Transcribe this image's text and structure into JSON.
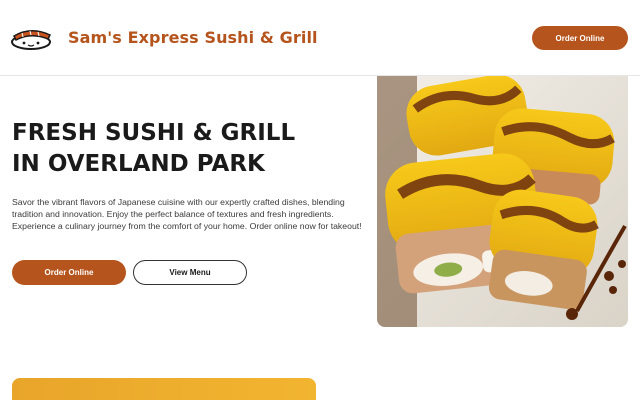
{
  "header": {
    "brand": "Sam's Express Sushi & Grill",
    "order_label": "Order Online",
    "logo_icon": "sushi-logo-icon"
  },
  "hero": {
    "title_line1": "FRESH SUSHI & GRILL",
    "title_line2": "IN OVERLAND PARK",
    "description": "Savor the vibrant flavors of Japanese cuisine with our expertly crafted dishes, blending tradition and innovation. Enjoy the perfect balance of textures and fresh ingredients. Experience a culinary journey from the comfort of your home. Order online now for takeout!",
    "primary_button": "Order Online",
    "secondary_button": "View Menu",
    "image_icon": "sushi-roll-photo"
  },
  "colors": {
    "brand": "#b5541c",
    "promo": "#f0b02d"
  }
}
